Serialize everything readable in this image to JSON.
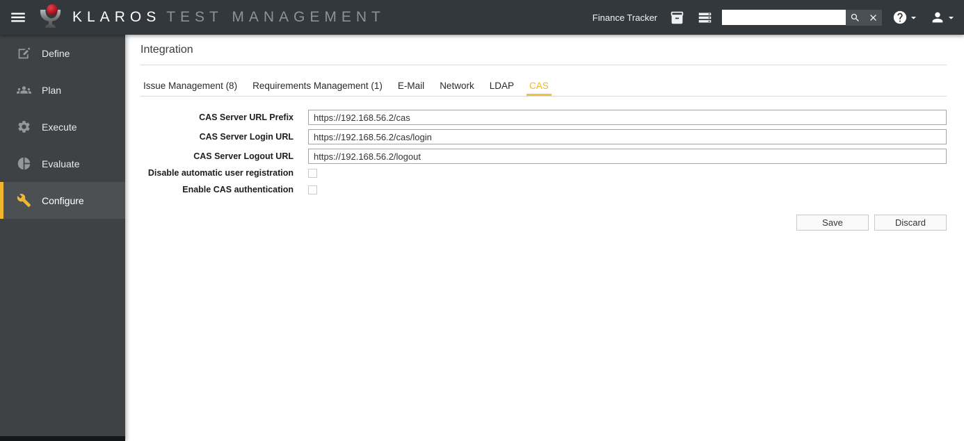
{
  "header": {
    "brand_name": "KLAROS",
    "brand_suffix": "TEST MANAGEMENT",
    "project_label": "Finance Tracker",
    "search": {
      "value": ""
    }
  },
  "sidebar": {
    "items": [
      {
        "label": "Define",
        "icon": "edit-icon",
        "active": false
      },
      {
        "label": "Plan",
        "icon": "group-icon",
        "active": false
      },
      {
        "label": "Execute",
        "icon": "gear-icon",
        "active": false
      },
      {
        "label": "Evaluate",
        "icon": "pie-chart-icon",
        "active": false
      },
      {
        "label": "Configure",
        "icon": "wrench-icon",
        "active": true
      }
    ]
  },
  "main": {
    "title": "Integration",
    "tabs": [
      {
        "label": "Issue Management (8)",
        "active": false
      },
      {
        "label": "Requirements Management (1)",
        "active": false
      },
      {
        "label": "E-Mail",
        "active": false
      },
      {
        "label": "Network",
        "active": false
      },
      {
        "label": "LDAP",
        "active": false
      },
      {
        "label": "CAS",
        "active": true
      }
    ],
    "form": {
      "fields": [
        {
          "label": "CAS Server URL Prefix",
          "value": "https://192.168.56.2/cas"
        },
        {
          "label": "CAS Server Login URL",
          "value": "https://192.168.56.2/cas/login"
        },
        {
          "label": "CAS Server Logout URL",
          "value": "https://192.168.56.2/logout"
        }
      ],
      "checkboxes": [
        {
          "label": "Disable automatic user registration",
          "checked": false
        },
        {
          "label": "Enable CAS authentication",
          "checked": false
        }
      ],
      "buttons": {
        "save": "Save",
        "discard": "Discard"
      }
    }
  },
  "colors": {
    "accent_yellow": "#efb82d",
    "header_bg": "#33383c",
    "sidebar_bg": "#3e4245",
    "active_item_bg": "#4c5053",
    "logo_red": "#c11f2e"
  }
}
